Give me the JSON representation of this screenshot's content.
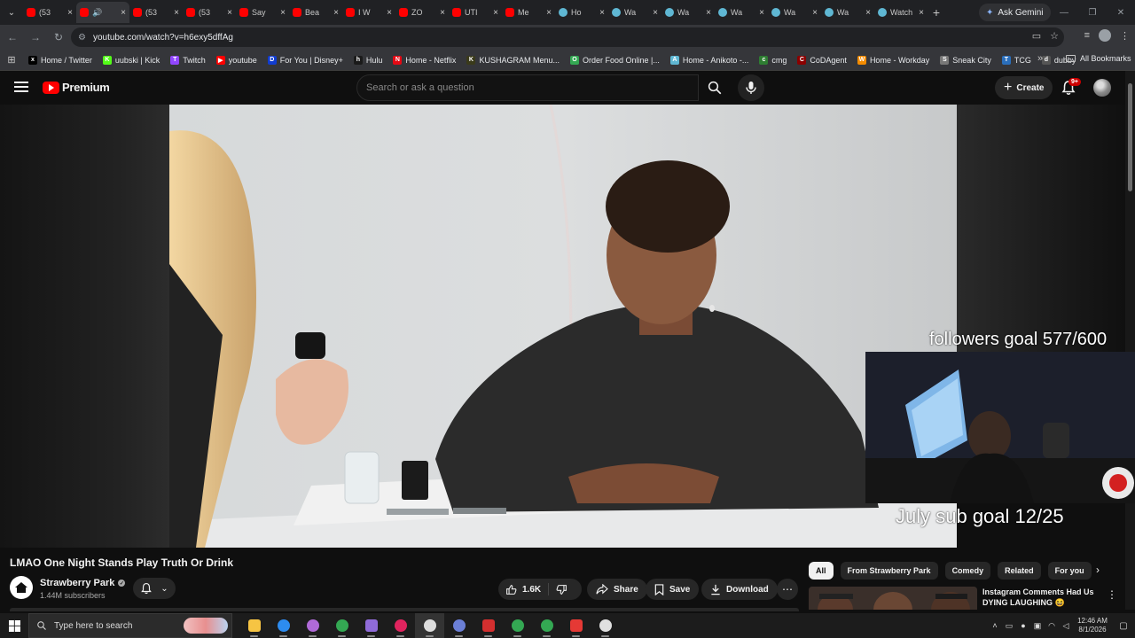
{
  "browser": {
    "tabs": [
      {
        "title": "(53",
        "favicon": "youtube"
      },
      {
        "title": "",
        "favicon": "youtube",
        "audio": true,
        "active": true
      },
      {
        "title": "(53",
        "favicon": "youtube"
      },
      {
        "title": "(53",
        "favicon": "youtube"
      },
      {
        "title": "Say",
        "favicon": "youtube"
      },
      {
        "title": "Bea",
        "favicon": "youtube"
      },
      {
        "title": "I W",
        "favicon": "youtube"
      },
      {
        "title": "ZO",
        "favicon": "youtube"
      },
      {
        "title": "UTI",
        "favicon": "youtube"
      },
      {
        "title": "Me",
        "favicon": "youtube"
      },
      {
        "title": "Ho",
        "favicon": "web"
      },
      {
        "title": "Wa",
        "favicon": "web"
      },
      {
        "title": "Wa",
        "favicon": "web"
      },
      {
        "title": "Wa",
        "favicon": "web"
      },
      {
        "title": "Wa",
        "favicon": "web"
      },
      {
        "title": "Wa",
        "favicon": "web"
      },
      {
        "title": "Watch",
        "favicon": "web"
      }
    ],
    "ask_gemini": "Ask Gemini",
    "url": "youtube.com/watch?v=h6exy5dffAg",
    "bookmarks": [
      {
        "label": "Home / Twitter",
        "icon": "x",
        "color": "#000000"
      },
      {
        "label": "uubski | Kick",
        "icon": "K",
        "color": "#53fc18"
      },
      {
        "label": "Twitch",
        "icon": "T",
        "color": "#9146ff"
      },
      {
        "label": "youtube",
        "icon": "▶",
        "color": "#ff0000"
      },
      {
        "label": "For You | Disney+",
        "icon": "D",
        "color": "#113ccf"
      },
      {
        "label": "Hulu",
        "icon": "h",
        "color": "#1a1a1a"
      },
      {
        "label": "Home - Netflix",
        "icon": "N",
        "color": "#e50914"
      },
      {
        "label": "KUSHAGRAM Menu...",
        "icon": "K",
        "color": "#3a3a1a"
      },
      {
        "label": "Order Food Online |...",
        "icon": "O",
        "color": "#34a853"
      },
      {
        "label": "Home - Anikoto -...",
        "icon": "A",
        "color": "#5fb7d3"
      },
      {
        "label": "cmg",
        "icon": "c",
        "color": "#2e7d32"
      },
      {
        "label": "CoDAgent",
        "icon": "C",
        "color": "#8b0000"
      },
      {
        "label": "Home - Workday",
        "icon": "W",
        "color": "#f38b00"
      },
      {
        "label": "Sneak City",
        "icon": "S",
        "color": "#777777"
      },
      {
        "label": "TCG",
        "icon": "T",
        "color": "#2a6ebb"
      },
      {
        "label": "dubby",
        "icon": "d",
        "color": "#555555"
      }
    ],
    "all_bookmarks": "All Bookmarks"
  },
  "youtube": {
    "logo_text": "Premium",
    "search_placeholder": "Search or ask a question",
    "create_label": "Create",
    "notification_count": "9+",
    "video": {
      "title": "LMAO One Night Stands Play Truth Or Drink",
      "channel": "Strawberry Park",
      "subscribers": "1.44M subscribers",
      "likes": "1.6K",
      "share_label": "Share",
      "save_label": "Save",
      "download_label": "Download"
    },
    "overlay": {
      "followers_goal": "followers goal 577/600",
      "sub_goal": "July sub goal 12/25"
    },
    "chips": [
      "All",
      "From Strawberry Park",
      "Comedy",
      "Related",
      "For you"
    ],
    "recommendation": {
      "title": "Instagram Comments Had Us DYING LAUGHING 😆"
    }
  },
  "taskbar": {
    "search_placeholder": "Type here to search",
    "time": "12:46 AM",
    "date": "8/1/2026",
    "apps": [
      {
        "name": "file-explorer",
        "color": "#f6c443"
      },
      {
        "name": "app-blue",
        "color": "#2d8cf0"
      },
      {
        "name": "app-purple",
        "color": "#b06ad8"
      },
      {
        "name": "chrome",
        "color": "#34a853"
      },
      {
        "name": "xbox",
        "color": "#8f6bd8"
      },
      {
        "name": "youtube-app",
        "color": "#e0245e"
      },
      {
        "name": "obs",
        "color": "#dddddd"
      },
      {
        "name": "app-circle",
        "color": "#6b7fd6"
      },
      {
        "name": "app-red",
        "color": "#d32f2f"
      },
      {
        "name": "chrome-2",
        "color": "#34a853"
      },
      {
        "name": "chrome-3",
        "color": "#34a853"
      },
      {
        "name": "app-a",
        "color": "#e53935"
      },
      {
        "name": "clock-app",
        "color": "#e0e0e0"
      }
    ]
  }
}
